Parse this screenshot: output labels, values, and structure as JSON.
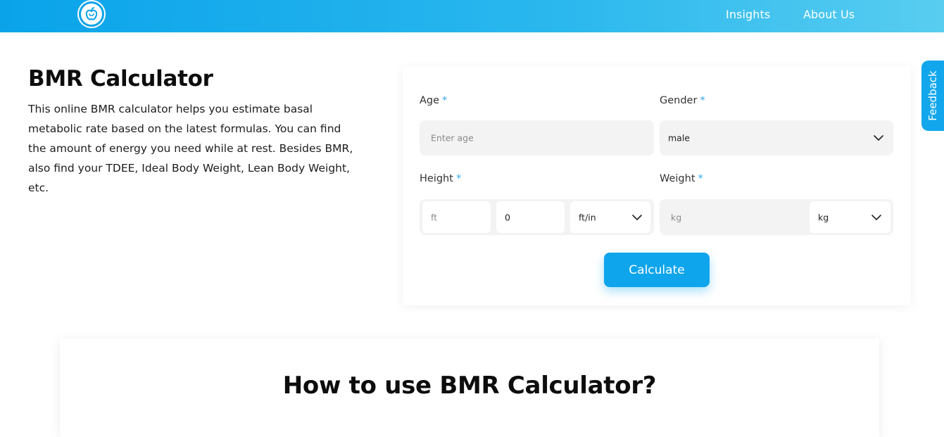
{
  "header": {
    "logo_icon": "apple-icon",
    "nav": [
      {
        "label": "Insights"
      },
      {
        "label": "About Us"
      }
    ],
    "gradient_start": "#0aa3ea",
    "gradient_end": "#58cdf0"
  },
  "hero": {
    "title": "BMR Calculator",
    "description": "This online BMR calculator helps you estimate basal metabolic rate based on the latest formulas. You can find the amount of energy you need while at rest. Besides BMR, also find your TDEE, Ideal Body Weight, Lean Body Weight, etc."
  },
  "form": {
    "age": {
      "label": "Age",
      "required": "*",
      "placeholder": "Enter age",
      "value": ""
    },
    "gender": {
      "label": "Gender",
      "required": "*",
      "selected": "male"
    },
    "height": {
      "label": "Height",
      "required": "*",
      "feet_placeholder": "ft",
      "inches_value": "0",
      "unit_selected": "ft/in"
    },
    "weight": {
      "label": "Weight",
      "required": "*",
      "placeholder": "kg",
      "unit_selected": "kg"
    },
    "calculate_label": "Calculate"
  },
  "feedback": {
    "label": "Feedback"
  },
  "howto": {
    "title": "How to use BMR Calculator?"
  },
  "colors": {
    "accent": "#0ea5ec",
    "required_mark": "#2fa6ef"
  }
}
